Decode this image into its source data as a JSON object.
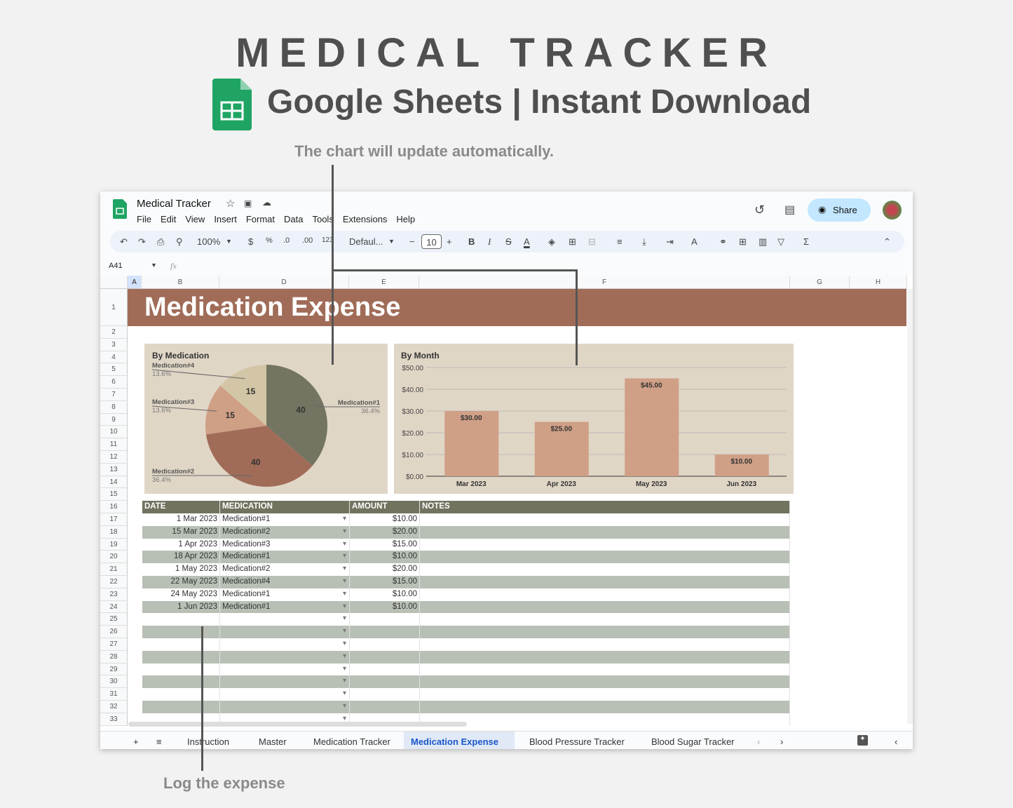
{
  "hero": {
    "title": "MEDICAL TRACKER",
    "subtitle": "Google Sheets | Instant Download",
    "caption_chart": "The chart will update automatically.",
    "caption_log": "Log the expense"
  },
  "app": {
    "doc_title": "Medical Tracker",
    "menu": [
      "File",
      "Edit",
      "View",
      "Insert",
      "Format",
      "Data",
      "Tools",
      "Extensions",
      "Help"
    ],
    "zoom": "100%",
    "font": "Defaul...",
    "font_size": "10",
    "share_label": "Share",
    "cell_ref": "A41",
    "fx": "fx",
    "toolbar": {
      "currency": "$",
      "percent": "%",
      "dec_less": ".0",
      "dec_more": ".00",
      "number_format": "123",
      "bold": "B",
      "italic": "I",
      "sigma": "Σ"
    },
    "columns": [
      "A",
      "B",
      "D",
      "E",
      "F",
      "G",
      "H"
    ]
  },
  "sheet": {
    "banner": "Medication Expense",
    "headers": [
      "DATE",
      "MEDICATION",
      "AMOUNT",
      "NOTES"
    ],
    "rows": [
      [
        "1 Mar 2023",
        "Medication#1",
        "$10.00"
      ],
      [
        "15 Mar 2023",
        "Medication#2",
        "$20.00"
      ],
      [
        "1 Apr 2023",
        "Medication#3",
        "$15.00"
      ],
      [
        "18 Apr 2023",
        "Medication#1",
        "$10.00"
      ],
      [
        "1 May 2023",
        "Medication#2",
        "$20.00"
      ],
      [
        "22 May 2023",
        "Medication#4",
        "$15.00"
      ],
      [
        "24 May 2023",
        "Medication#1",
        "$10.00"
      ],
      [
        "1 Jun 2023",
        "Medication#1",
        "$10.00"
      ]
    ]
  },
  "tabs": [
    "Instruction",
    "Master",
    "Medication Tracker",
    "Medication Expense",
    "Blood Pressure Tracker",
    "Blood Sugar Tracker"
  ],
  "active_tab": "Medication Expense",
  "colors": {
    "banner": "#a06c58",
    "header": "#72735f",
    "band": "#b8c0b6",
    "chart_bg": "#e0d6c6",
    "accent": "#c2e7ff"
  },
  "chart_data": [
    {
      "type": "pie",
      "title": "By Medication",
      "categories": [
        "Medication#1",
        "Medication#2",
        "Medication#3",
        "Medication#4"
      ],
      "values": [
        40,
        40,
        15,
        15
      ],
      "percent_labels": [
        "36.4%",
        "36.4%",
        "13.6%",
        "13.6%"
      ],
      "colors": [
        "#737562",
        "#a06c58",
        "#cf9f86",
        "#d3c6a6"
      ]
    },
    {
      "type": "bar",
      "title": "By Month",
      "categories": [
        "Mar 2023",
        "Apr 2023",
        "May 2023",
        "Jun 2023"
      ],
      "values": [
        30,
        25,
        45,
        10
      ],
      "data_labels": [
        "$30.00",
        "$25.00",
        "$45.00",
        "$10.00"
      ],
      "yticks": [
        "$0.00",
        "$10.00",
        "$20.00",
        "$30.00",
        "$40.00",
        "$50.00"
      ],
      "ylim": [
        0,
        50
      ],
      "grid": true,
      "color": "#cf9f86"
    }
  ]
}
